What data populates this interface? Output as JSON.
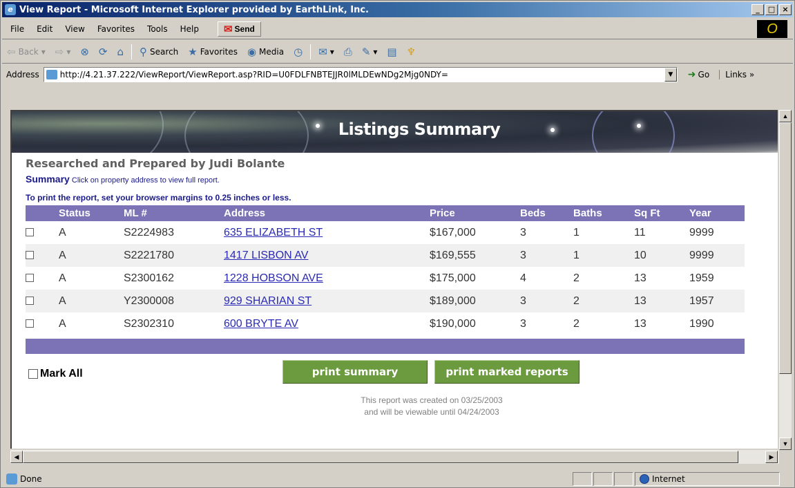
{
  "window": {
    "title": "View Report - Microsoft Internet Explorer provided by EarthLink, Inc.",
    "caption_buttons": [
      "_",
      "□",
      "×"
    ]
  },
  "menu": {
    "items": [
      "File",
      "Edit",
      "View",
      "Favorites",
      "Tools",
      "Help"
    ],
    "send_label": "Send"
  },
  "toolbar": {
    "back": "Back",
    "search": "Search",
    "favorites": "Favorites",
    "media": "Media"
  },
  "addressbar": {
    "label": "Address",
    "url": "http://4.21.37.222/ViewReport/ViewReport.asp?RID=U0FDLFNBTEJJR0lMLDEwNDg2Mjg0NDY=",
    "go_label": "Go",
    "links_label": "Links »"
  },
  "page": {
    "banner_title": "Listings Summary",
    "prepared_by": "Researched and Prepared by Judi Bolante",
    "summary_heading": "Summary",
    "summary_hint": "Click on property address to view full report.",
    "print_tip": "To print the report, set your browser margins to 0.25 inches or less.",
    "columns": [
      "",
      "Status",
      "ML #",
      "Address",
      "Price",
      "Beds",
      "Baths",
      "Sq Ft",
      "Year"
    ],
    "rows": [
      {
        "status": "A",
        "ml": "S2224983",
        "address": "635 ELIZABETH ST",
        "price": "$167,000",
        "beds": "3",
        "baths": "1",
        "sqft": "11",
        "year": "9999"
      },
      {
        "status": "A",
        "ml": "S2221780",
        "address": "1417 LISBON AV",
        "price": "$169,555",
        "beds": "3",
        "baths": "1",
        "sqft": "10",
        "year": "9999"
      },
      {
        "status": "A",
        "ml": "S2300162",
        "address": "1228 HOBSON AVE",
        "price": "$175,000",
        "beds": "4",
        "baths": "2",
        "sqft": "13",
        "year": "1959"
      },
      {
        "status": "A",
        "ml": "Y2300008",
        "address": "929 SHARIAN ST",
        "price": "$189,000",
        "beds": "3",
        "baths": "2",
        "sqft": "13",
        "year": "1957"
      },
      {
        "status": "A",
        "ml": "S2302310",
        "address": "600 BRYTE AV",
        "price": "$190,000",
        "beds": "3",
        "baths": "2",
        "sqft": "13",
        "year": "1990"
      }
    ],
    "mark_all_label": "Mark All",
    "print_summary_label": "print summary",
    "print_marked_label": "print marked reports",
    "created_line1": "This report was created on 03/25/2003",
    "created_line2": "and will be viewable until 04/24/2003"
  },
  "statusbar": {
    "status_text": "Done",
    "zone": "Internet"
  },
  "colors": {
    "table_header": "#7b73b6",
    "link": "#2a2ab5",
    "button_green": "#6b9a3f",
    "title_bar": "#0a246a"
  }
}
